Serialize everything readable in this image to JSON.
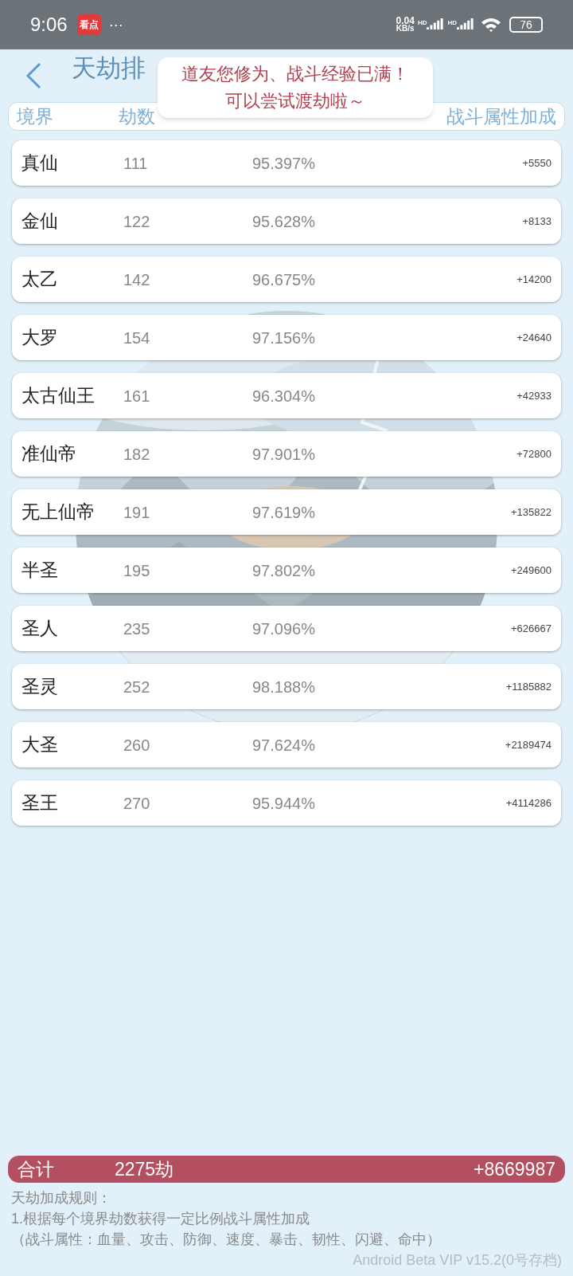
{
  "status_bar": {
    "time": "9:06",
    "app_icon_text": "看点",
    "more": "···",
    "net_speed_value": "0.04",
    "net_speed_unit": "KB/s",
    "sim_labels": [
      "HD",
      "HD"
    ],
    "battery": "76"
  },
  "header": {
    "title": "天劫排"
  },
  "toast": {
    "lines": [
      "道友您修为、战斗经验已满！",
      "可以尝试渡劫啦～"
    ]
  },
  "table": {
    "columns": [
      "境界",
      "劫数",
      "战斗属性加成"
    ],
    "rows": [
      {
        "realm": "真仙",
        "count": "111",
        "percent": "95.397%",
        "bonus": "+5550"
      },
      {
        "realm": "金仙",
        "count": "122",
        "percent": "95.628%",
        "bonus": "+8133"
      },
      {
        "realm": "太乙",
        "count": "142",
        "percent": "96.675%",
        "bonus": "+14200"
      },
      {
        "realm": "大罗",
        "count": "154",
        "percent": "97.156%",
        "bonus": "+24640"
      },
      {
        "realm": "太古仙王",
        "count": "161",
        "percent": "96.304%",
        "bonus": "+42933"
      },
      {
        "realm": "准仙帝",
        "count": "182",
        "percent": "97.901%",
        "bonus": "+72800"
      },
      {
        "realm": "无上仙帝",
        "count": "191",
        "percent": "97.619%",
        "bonus": "+135822"
      },
      {
        "realm": "半圣",
        "count": "195",
        "percent": "97.802%",
        "bonus": "+249600"
      },
      {
        "realm": "圣人",
        "count": "235",
        "percent": "97.096%",
        "bonus": "+626667"
      },
      {
        "realm": "圣灵",
        "count": "252",
        "percent": "98.188%",
        "bonus": "+1185882"
      },
      {
        "realm": "大圣",
        "count": "260",
        "percent": "97.624%",
        "bonus": "+2189474"
      },
      {
        "realm": "圣王",
        "count": "270",
        "percent": "95.944%",
        "bonus": "+4114286"
      }
    ]
  },
  "total": {
    "label": "合计",
    "count": "2275劫",
    "bonus": "+8669987"
  },
  "rules": [
    "天劫加成规则：",
    "1.根据每个境界劫数获得一定比例战斗属性加成",
    "（战斗属性：血量、攻击、防御、速度、暴击、韧性、闪避、命中）"
  ],
  "version": "Android Beta VIP v15.2(0号存档)"
}
